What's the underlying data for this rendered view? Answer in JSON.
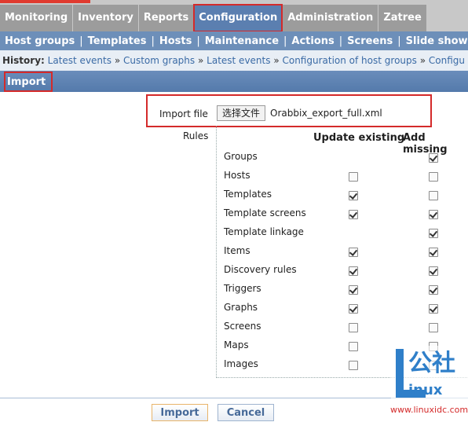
{
  "top_menu": [
    {
      "label": "Monitoring"
    },
    {
      "label": "Inventory"
    },
    {
      "label": "Reports"
    },
    {
      "label": "Configuration"
    },
    {
      "label": "Administration"
    },
    {
      "label": "Zatree"
    }
  ],
  "sub_menu": [
    {
      "label": "Host groups"
    },
    {
      "label": "Templates"
    },
    {
      "label": "Hosts"
    },
    {
      "label": "Maintenance"
    },
    {
      "label": "Actions"
    },
    {
      "label": "Screens"
    },
    {
      "label": "Slide shows"
    }
  ],
  "history": {
    "label": "History:",
    "items": [
      "Latest events",
      "Custom graphs",
      "Latest events",
      "Configuration of host groups",
      "Configu"
    ],
    "separator": "»"
  },
  "section": {
    "title": "Import"
  },
  "import_file": {
    "label": "Import file",
    "button": "选择文件",
    "filename": "Orabbix_export_full.xml"
  },
  "rules": {
    "label": "Rules",
    "col_update": "Update existing",
    "col_add": "Add missing",
    "rows": [
      {
        "name": "Groups",
        "update": null,
        "add": true
      },
      {
        "name": "Hosts",
        "update": false,
        "add": false
      },
      {
        "name": "Templates",
        "update": true,
        "add": false
      },
      {
        "name": "Template screens",
        "update": true,
        "add": true
      },
      {
        "name": "Template linkage",
        "update": null,
        "add": true
      },
      {
        "name": "Items",
        "update": true,
        "add": true
      },
      {
        "name": "Discovery rules",
        "update": true,
        "add": true
      },
      {
        "name": "Triggers",
        "update": true,
        "add": true
      },
      {
        "name": "Graphs",
        "update": true,
        "add": true
      },
      {
        "name": "Screens",
        "update": false,
        "add": false
      },
      {
        "name": "Maps",
        "update": false,
        "add": false
      },
      {
        "name": "Images",
        "update": false,
        "add": false
      }
    ]
  },
  "buttons": {
    "import": "Import",
    "cancel": "Cancel"
  },
  "watermark": {
    "brand": "公社",
    "sub": "inux",
    "url": "www.linuxidc.com"
  },
  "colors": {
    "accent": "#5b7fb0",
    "highlight": "#d42a2a"
  }
}
